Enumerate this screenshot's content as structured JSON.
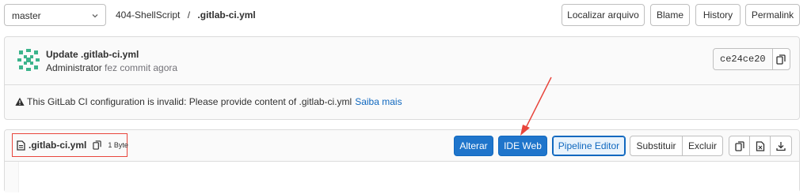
{
  "branch": {
    "selected": "master"
  },
  "breadcrumb": {
    "project": "404-ShellScript",
    "separator": "/",
    "file": ".gitlab-ci.yml"
  },
  "toolbar": {
    "find_file": "Localizar arquivo",
    "blame": "Blame",
    "history": "History",
    "permalink": "Permalink"
  },
  "commit": {
    "title": "Update .gitlab-ci.yml",
    "author": "Administrator",
    "time_text": "fez commit agora",
    "sha": "ce24ce20"
  },
  "alert": {
    "message": "This GitLab CI configuration is invalid: Please provide content of .gitlab-ci.yml",
    "link": "Saiba mais"
  },
  "file_header": {
    "name": ".gitlab-ci.yml",
    "size": "1 Byte",
    "buttons": {
      "edit": "Alterar",
      "web_ide": "IDE Web",
      "pipeline_editor": "Pipeline Editor",
      "replace": "Substituir",
      "delete": "Excluir"
    }
  },
  "icons": [
    "chevron-down-icon",
    "avatar-identicon",
    "copy-icon",
    "warning-icon",
    "file-icon",
    "copy-icon",
    "raw-file-icon",
    "download-icon"
  ],
  "colors": {
    "primary": "#1f75cb",
    "link": "#1068bf",
    "annotation": "#e8453c",
    "identicon": "#3cb48c"
  }
}
